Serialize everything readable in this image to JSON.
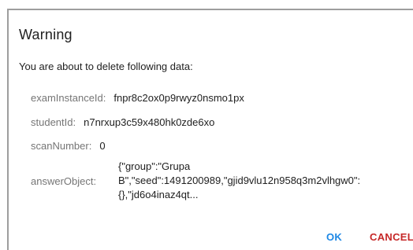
{
  "dialog": {
    "title": "Warning",
    "intro": "You are about to delete following data:",
    "fields": [
      {
        "label": "examInstanceId:",
        "value": "fnpr8c2ox0p9rwyz0nsmo1px"
      },
      {
        "label": "studentId:",
        "value": "n7nrxup3c59x480hk0zde6xo"
      },
      {
        "label": "scanNumber:",
        "value": "0"
      }
    ],
    "answer": {
      "label": "answerObject:",
      "lines": [
        "{\"group\":\"Grupa",
        "B\",\"seed\":1491200989,\"gjid9vlu12n958q3m2vlhgw0\":",
        "{},\"jd6o4inaz4qt..."
      ]
    },
    "buttons": {
      "ok_label": "OK",
      "cancel_label": "CANCEL"
    },
    "colors": {
      "ok": "#1e88e5",
      "cancel": "#c62828"
    }
  }
}
